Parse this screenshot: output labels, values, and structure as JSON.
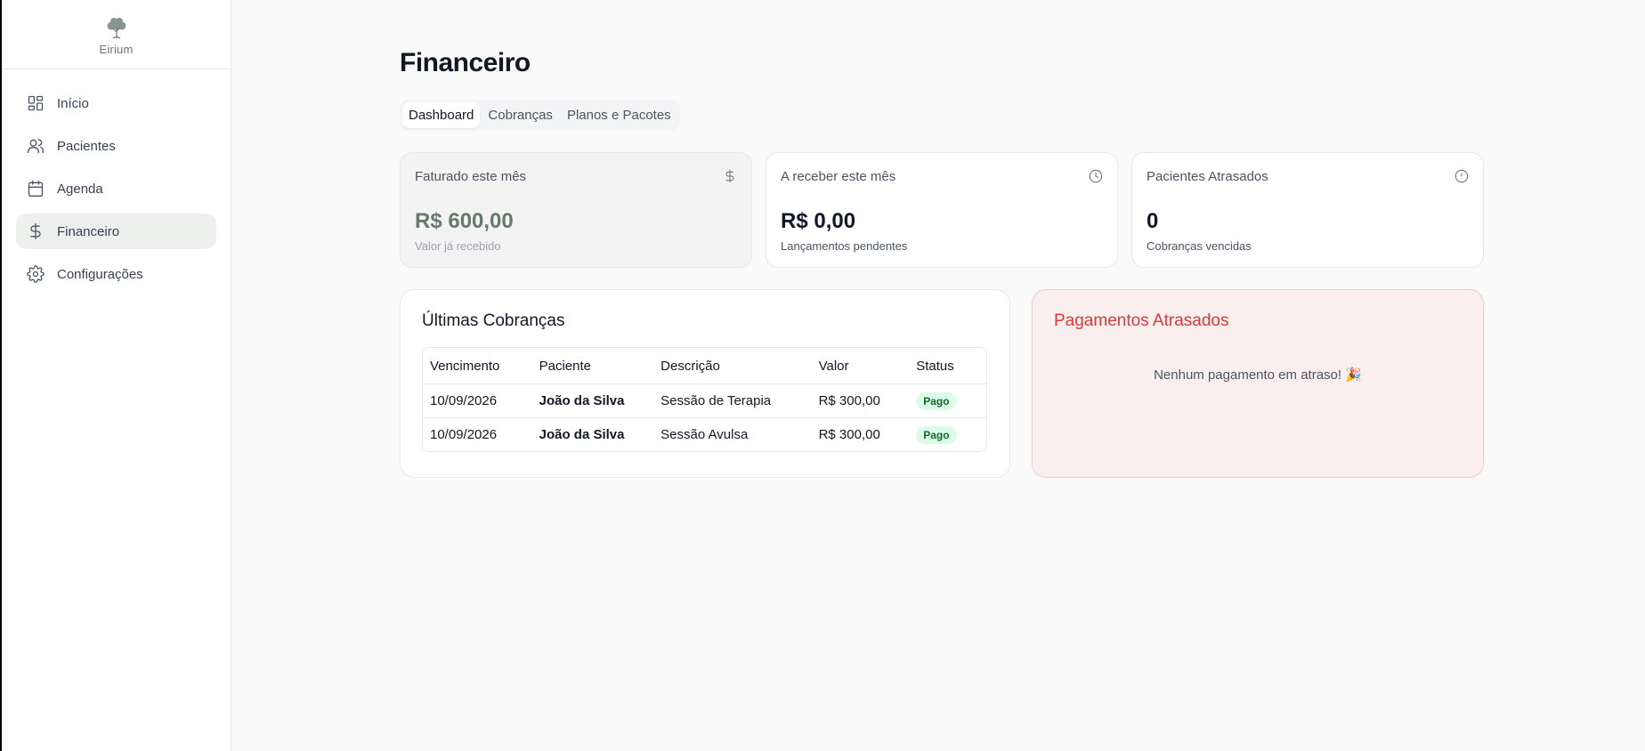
{
  "brand": {
    "name": "Eirium"
  },
  "sidebar": {
    "items": [
      {
        "label": "Início",
        "icon": "dashboard-grid-icon",
        "active": false
      },
      {
        "label": "Pacientes",
        "icon": "users-icon",
        "active": false
      },
      {
        "label": "Agenda",
        "icon": "calendar-icon",
        "active": false
      },
      {
        "label": "Financeiro",
        "icon": "dollar-icon",
        "active": true
      },
      {
        "label": "Configurações",
        "icon": "gear-icon",
        "active": false
      }
    ]
  },
  "page": {
    "title": "Financeiro"
  },
  "tabs": [
    {
      "label": "Dashboard",
      "active": true
    },
    {
      "label": "Cobranças",
      "active": false
    },
    {
      "label": "Planos e Pacotes",
      "active": false
    }
  ],
  "cards": [
    {
      "label": "Faturado este mês",
      "value": "R$ 600,00",
      "sub": "Valor já recebido",
      "icon": "dollar-icon"
    },
    {
      "label": "A receber este mês",
      "value": "R$ 0,00",
      "sub": "Lançamentos pendentes",
      "icon": "clock-icon"
    },
    {
      "label": "Pacientes Atrasados",
      "value": "0",
      "sub": "Cobranças vencidas",
      "icon": "alert-circle-icon"
    }
  ],
  "charges": {
    "title": "Últimas Cobranças",
    "columns": [
      "Vencimento",
      "Paciente",
      "Descrição",
      "Valor",
      "Status"
    ],
    "rows": [
      {
        "due": "10/09/2026",
        "patient": "João da Silva",
        "description": "Sessão de Terapia",
        "amount": "R$ 300,00",
        "status": "Pago"
      },
      {
        "due": "10/09/2026",
        "patient": "João da Silva",
        "description": "Sessão Avulsa",
        "amount": "R$ 300,00",
        "status": "Pago"
      }
    ]
  },
  "overdue": {
    "title": "Pagamentos Atrasados",
    "empty_message": "Nenhum pagamento em atraso! 🎉"
  },
  "colors": {
    "accent_green": "#667a6b",
    "danger_red": "#d63b3b",
    "paid_badge_bg": "#dcfce7",
    "paid_badge_text": "#166534"
  }
}
